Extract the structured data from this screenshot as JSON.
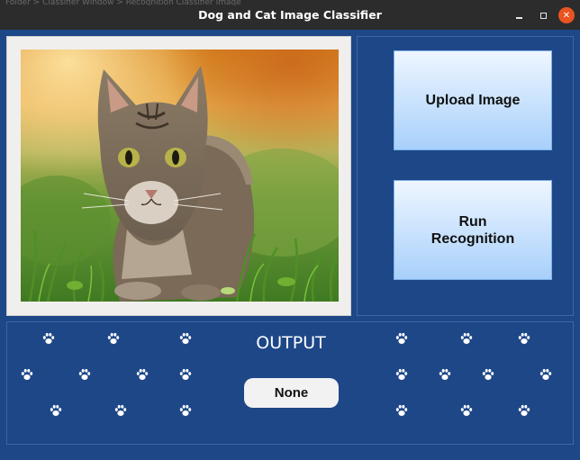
{
  "window": {
    "title": "Dog and Cat Image Classifier",
    "ghost_title": "Folder > Classifier Window > Recognition Classifier Image"
  },
  "image_panel": {
    "image_subject": "tabby cat in grass"
  },
  "buttons": {
    "upload_label": "Upload Image",
    "run_label": "Run Recognition"
  },
  "output": {
    "heading": "OUTPUT",
    "result_value": "None"
  },
  "decor": {
    "paw_icon": "paw-print-icon"
  },
  "colors": {
    "background": "#1e4788",
    "title_bar": "#2c2c2c",
    "close_button": "#e95420",
    "button_gradient_top": "#eef6ff",
    "button_gradient_bottom": "#a8d0fb"
  }
}
